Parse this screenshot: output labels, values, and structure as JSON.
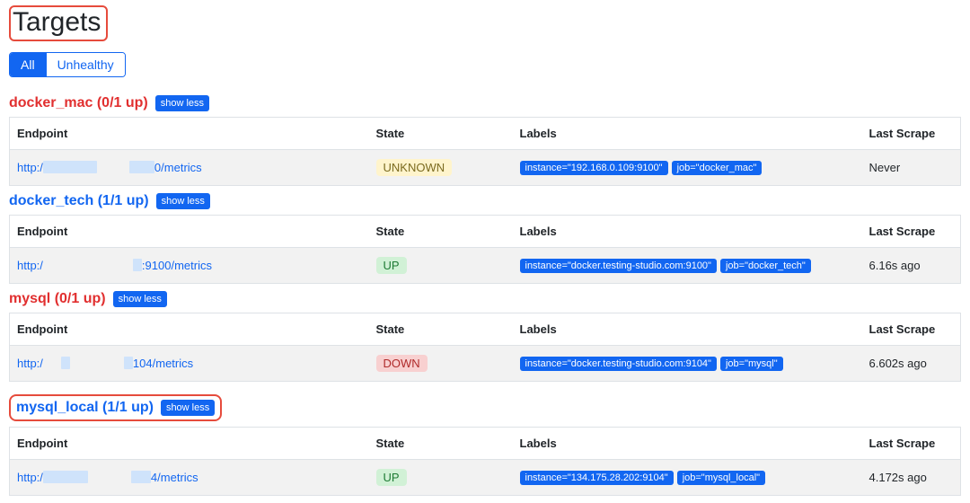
{
  "page_title": "Targets",
  "filters": {
    "all": "All",
    "unhealthy": "Unhealthy",
    "active": "all"
  },
  "columns": {
    "endpoint": "Endpoint",
    "state": "State",
    "labels": "Labels",
    "last_scrape": "Last Scrape"
  },
  "show_less_label": "show less",
  "pools": [
    {
      "name": "docker_mac",
      "up_count": "(0/1 up)",
      "status": "down",
      "highlight": false,
      "targets": [
        {
          "endpoint_prefix": "http:/",
          "endpoint_mid": "0",
          "endpoint_suffix": "/metrics",
          "mask_style": "a",
          "state": "UNKNOWN",
          "state_class": "state-unknown",
          "labels": [
            "instance=\"192.168.0.109:9100\"",
            "job=\"docker_mac\""
          ],
          "last_scrape": "Never"
        }
      ]
    },
    {
      "name": "docker_tech",
      "up_count": "(1/1 up)",
      "status": "up",
      "highlight": false,
      "targets": [
        {
          "endpoint_prefix": "http:/",
          "endpoint_mid": ":9100",
          "endpoint_suffix": "/metrics",
          "mask_style": "b",
          "state": "UP",
          "state_class": "state-up",
          "labels": [
            "instance=\"docker.testing-studio.com:9100\"",
            "job=\"docker_tech\""
          ],
          "last_scrape": "6.16s ago"
        }
      ]
    },
    {
      "name": "mysql",
      "up_count": "(0/1 up)",
      "status": "down",
      "highlight": false,
      "targets": [
        {
          "endpoint_prefix": "http:/",
          "endpoint_mid": "104",
          "endpoint_suffix": "/metrics",
          "mask_style": "c",
          "state": "DOWN",
          "state_class": "state-down",
          "labels": [
            "instance=\"docker.testing-studio.com:9104\"",
            "job=\"mysql\""
          ],
          "last_scrape": "6.602s ago"
        }
      ]
    },
    {
      "name": "mysql_local",
      "up_count": "(1/1 up)",
      "status": "up",
      "highlight": true,
      "targets": [
        {
          "endpoint_prefix": "http:/",
          "endpoint_mid": "4",
          "endpoint_suffix": "/metrics",
          "mask_style": "d",
          "state": "UP",
          "state_class": "state-up",
          "labels": [
            "instance=\"134.175.28.202:9104\"",
            "job=\"mysql_local\""
          ],
          "last_scrape": "4.172s ago"
        }
      ]
    }
  ]
}
